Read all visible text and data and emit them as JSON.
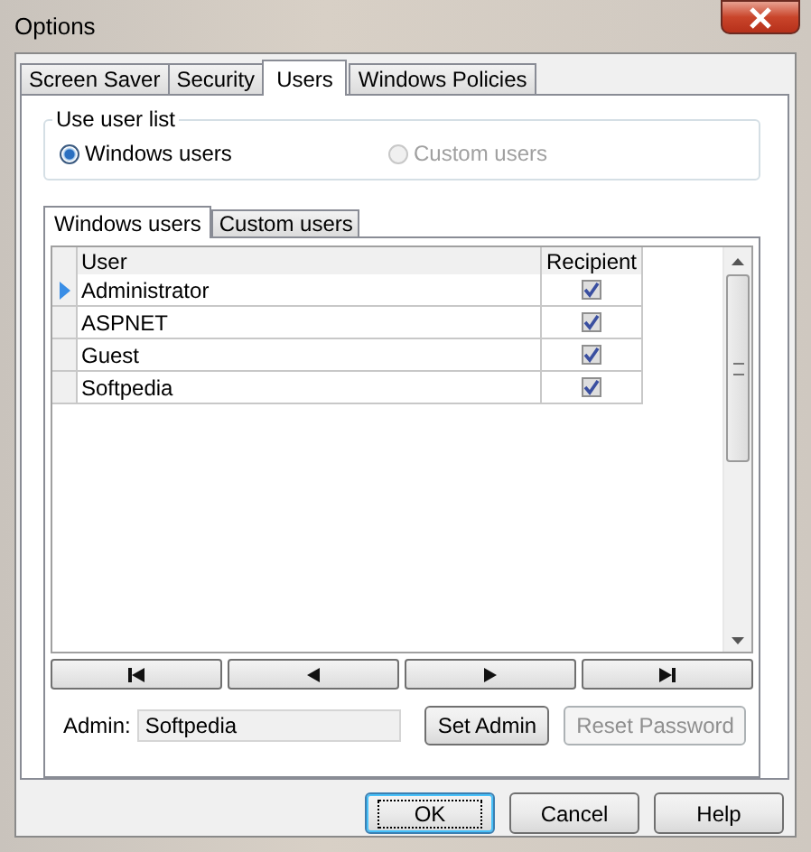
{
  "window": {
    "title": "Options"
  },
  "tabs": [
    {
      "label": "Screen Saver",
      "selected": false
    },
    {
      "label": "Security",
      "selected": false
    },
    {
      "label": "Users",
      "selected": true
    },
    {
      "label": "Windows Policies",
      "selected": false
    }
  ],
  "user_list": {
    "title": "Use user list",
    "options": [
      {
        "label": "Windows users",
        "selected": true,
        "disabled": false
      },
      {
        "label": "Custom  users",
        "selected": false,
        "disabled": true
      }
    ]
  },
  "inner_tabs": [
    {
      "label": "Windows users",
      "selected": true
    },
    {
      "label": "Custom users",
      "selected": false
    }
  ],
  "table": {
    "columns": [
      "User",
      "Recipient"
    ],
    "rows": [
      {
        "user": "Administrator",
        "recipient": true,
        "current": true
      },
      {
        "user": "ASPNET",
        "recipient": true,
        "current": false
      },
      {
        "user": "Guest",
        "recipient": true,
        "current": false
      },
      {
        "user": "Softpedia",
        "recipient": true,
        "current": false
      }
    ]
  },
  "navigator": [
    {
      "kind": "first"
    },
    {
      "kind": "prev"
    },
    {
      "kind": "next"
    },
    {
      "kind": "last"
    }
  ],
  "admin": {
    "label": "Admin:",
    "value": "Softpedia"
  },
  "admin_buttons": [
    {
      "label": "Set Admin",
      "disabled": false
    },
    {
      "label": "Reset Password",
      "disabled": true
    }
  ],
  "buttons": [
    {
      "label": "OK",
      "default": true
    },
    {
      "label": "Cancel",
      "default": false
    },
    {
      "label": "Help",
      "default": false
    }
  ]
}
